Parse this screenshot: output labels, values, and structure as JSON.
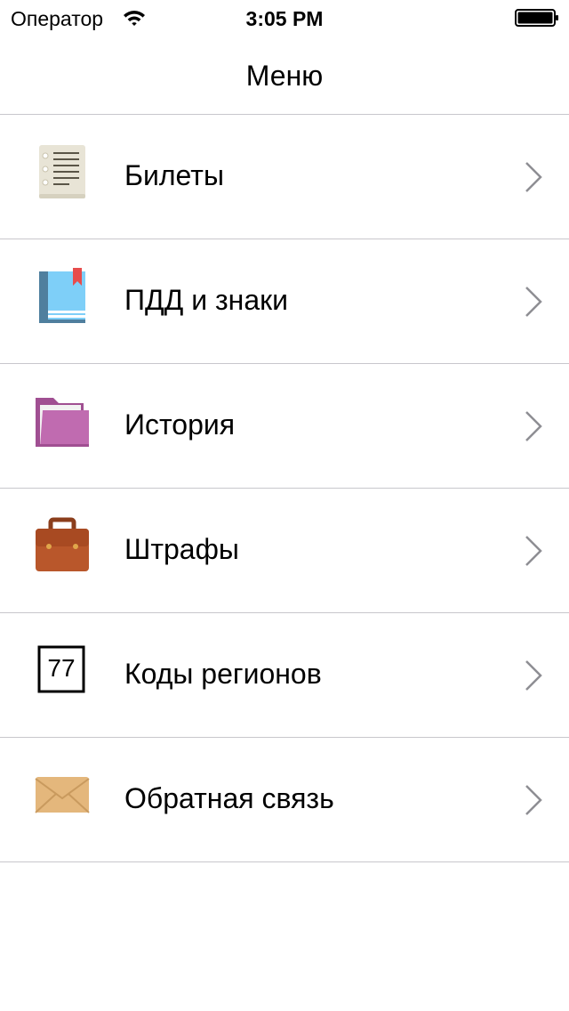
{
  "status_bar": {
    "carrier": "Оператор",
    "time": "3:05 PM"
  },
  "nav": {
    "title": "Меню"
  },
  "menu": {
    "items": [
      {
        "label": "Билеты",
        "icon": "notepad-icon"
      },
      {
        "label": "ПДД и знаки",
        "icon": "book-icon"
      },
      {
        "label": "История",
        "icon": "folder-icon"
      },
      {
        "label": "Штрафы",
        "icon": "briefcase-icon"
      },
      {
        "label": "Коды регионов",
        "icon": "region-code-icon",
        "code": "77"
      },
      {
        "label": "Обратная связь",
        "icon": "envelope-icon"
      }
    ]
  },
  "colors": {
    "separator": "#c8c7cc",
    "chevron": "#8e8e93",
    "book": "#7ecff8",
    "folder": "#c06bb0",
    "briefcase": "#b9572b",
    "envelope": "#e4b77c"
  }
}
